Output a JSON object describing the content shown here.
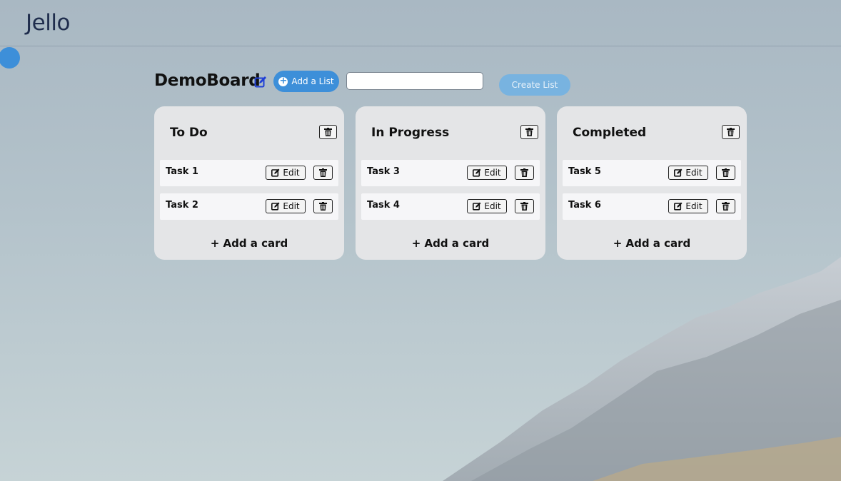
{
  "app": {
    "brand": "Jello"
  },
  "board": {
    "title": "DemoBoard",
    "add_list_label": "Add a List",
    "new_list_value": "",
    "create_list_label": "Create List"
  },
  "lists": [
    {
      "title": "To Do",
      "cards": [
        {
          "title": "Task 1"
        },
        {
          "title": "Task 2"
        }
      ]
    },
    {
      "title": "In Progress",
      "cards": [
        {
          "title": "Task 3"
        },
        {
          "title": "Task 4"
        }
      ]
    },
    {
      "title": "Completed",
      "cards": [
        {
          "title": "Task 5"
        },
        {
          "title": "Task 6"
        }
      ]
    }
  ],
  "labels": {
    "edit": "Edit",
    "add_card": "+ Add a card"
  },
  "icons": {
    "board_edit": "edit-icon",
    "delete": "trash-icon",
    "card_edit": "edit-icon",
    "add_list": "plus-circle-icon"
  },
  "colors": {
    "accent": "#3d8fd9",
    "brand_text": "#1f2d4d",
    "list_bg": "#e4e5e7"
  }
}
